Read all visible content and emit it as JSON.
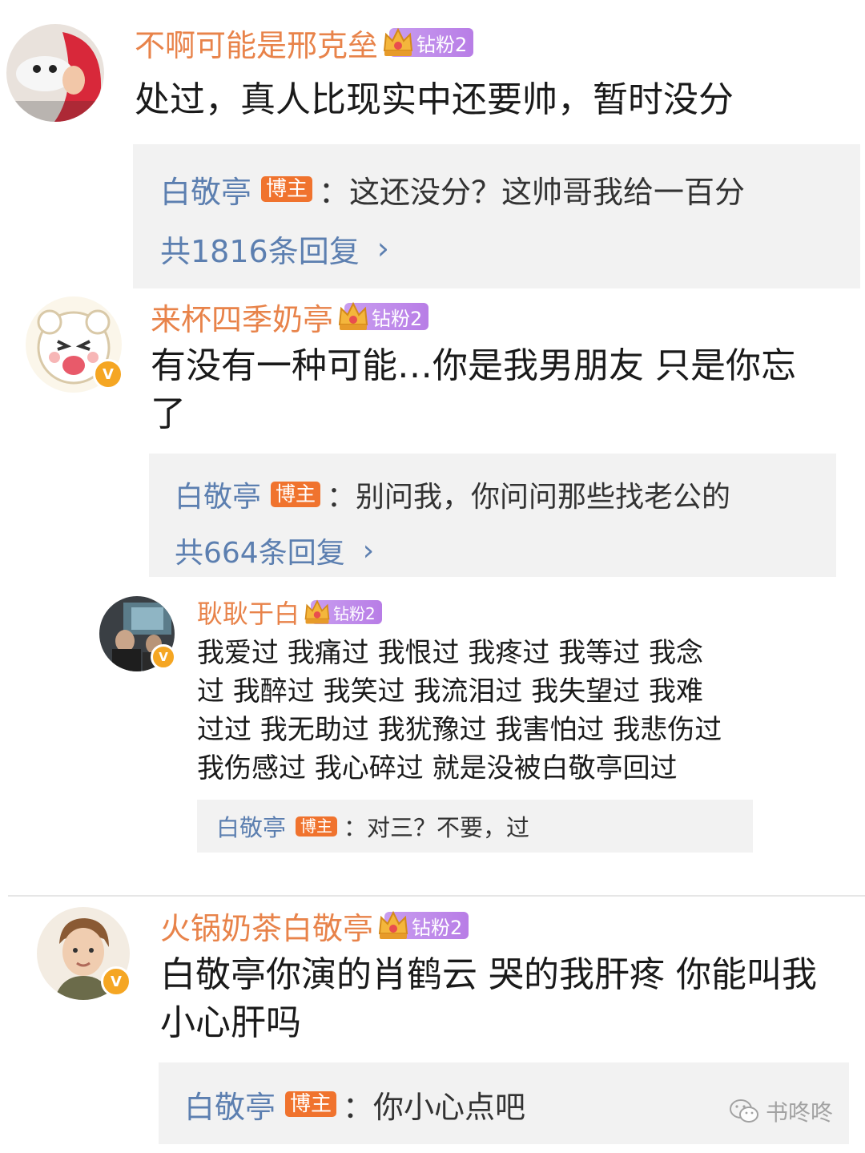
{
  "comments": [
    {
      "username": "不啊可能是邢克垒",
      "fan_badge": "钻粉2",
      "text": "处过，真人比现实中还要帅，暂时没分",
      "reply": {
        "name": "白敬亭",
        "host_badge": "博主",
        "text": "：这还没分？这帅哥我给一百分"
      },
      "reply_count": "共1816条回复"
    },
    {
      "username": "来杯四季奶亭",
      "fan_badge": "钻粉2",
      "text_line1": "有没有一种可能…你是我男朋友 只是你忘",
      "text_line2": "了",
      "reply": {
        "name": "白敬亭",
        "host_badge": "博主",
        "text": "：别问我，你问问那些找老公的"
      },
      "reply_count": "共664条回复"
    },
    {
      "username": "耿耿于白",
      "fan_badge": "钻粉2",
      "lines": [
        "我爱过 我痛过 我恨过 我疼过 我等过 我念",
        "过 我醉过 我笑过 我流泪过 我失望过 我难",
        "过过 我无助过 我犹豫过 我害怕过 我悲伤过",
        "我伤感过 我心碎过 就是没被白敬亭回过"
      ],
      "reply": {
        "name": "白敬亭",
        "host_badge": "博主",
        "text": "：对三？不要，过"
      }
    },
    {
      "username": "火锅奶茶白敬亭",
      "fan_badge": "钻粉2",
      "text_line1": "白敬亭你演的肖鹤云 哭的我肝疼  你能叫我",
      "text_line2": "小心肝吗",
      "reply": {
        "name": "白敬亭",
        "host_badge": "博主",
        "text": "：你小心点吧"
      }
    }
  ],
  "chevron": "›",
  "verified_mark": "V",
  "watermark": "书咚咚"
}
